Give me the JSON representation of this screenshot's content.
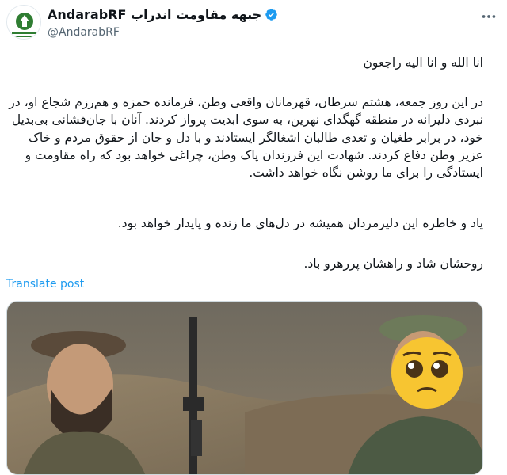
{
  "author": {
    "display_name": "AndarabRF جبهه مقاومت اندراب",
    "handle": "@AndarabRF",
    "avatar_icon": "resistance-front-emblem",
    "verified_icon": "verified-badge-icon"
  },
  "tweet": {
    "paragraphs": [
      "انا الله و انا الیه راجعون",
      "در این روز جمعه، هشتم سرطان، قهرمانان واقعی وطن، فرمانده حمزه و هم‌رزم شجاع او، در نبردی دلیرانه در منطقه گهگدای نهرین، به سوی ابدیت پرواز کردند. آنان با جان‌فشانی بی‌بدیل خود، در برابر طغیان و تعدی طالبان اشغالگر ایستادند و با دل و جان از حقوق مردم و خاک عزیز وطن دفاع کردند. شهادت این فرزندان پاک وطن، چراغی خواهد بود که راه مقاومت و ایستادگی را برای ما روشن نگاه خواهد داشت.",
      "یاد و خاطره این دلیرمردان همیشه در دل‌های ما زنده و پایدار خواهد بود.",
      "روحشان شاد و راهشان پررهرو باد."
    ],
    "translate_label": "Translate post",
    "media_icon": "photo-of-two-fighters-with-emoji-over-face"
  },
  "colors": {
    "link": "#1d9bf0",
    "verified": "#1d9bf0",
    "secondary_text": "#536471",
    "emblem_green": "#2f7d32"
  }
}
